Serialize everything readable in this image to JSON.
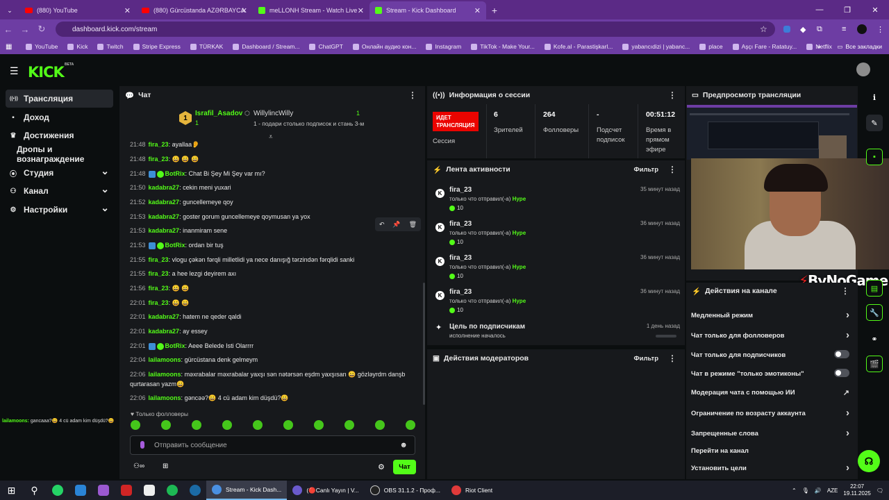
{
  "browser": {
    "tabs": [
      {
        "label": "(880) YouTube",
        "icon": "youtube-icon"
      },
      {
        "label": "(880) Gürcüstanda AZƏRBAYCA",
        "icon": "youtube-icon"
      },
      {
        "label": "meLLONH Stream - Watch Live",
        "icon": "kick-icon"
      },
      {
        "label": "Stream - Kick Dashboard",
        "icon": "kick-icon",
        "active": true
      }
    ],
    "url": "dashboard.kick.com/stream",
    "bookmarks": [
      "YouTube",
      "Kick",
      "Twitch",
      "Stripe Express",
      "TÜRKAK",
      "Dashboard / Stream...",
      "ChatGPT",
      "Онлайн аудио кон...",
      "Instagram",
      "TikTok - Make Your...",
      "Kofe.al - Parastişkarl...",
      "yabancıdizi | yabanc...",
      "place",
      "Aşçı Fare - Ratatuy...",
      "Netflix"
    ],
    "all_bookmarks": "Все закладки"
  },
  "kick": {
    "logo": "KICK",
    "beta": "BETA"
  },
  "sidebar": {
    "items": [
      {
        "label": "Трансляция",
        "icon": "broadcast-icon",
        "selected": true
      },
      {
        "label": "Доход",
        "icon": "wallet-icon"
      },
      {
        "label": "Достижения",
        "icon": "trophy-icon"
      },
      {
        "label": "Дропы и вознаграждение",
        "icon": ""
      },
      {
        "label": "Студия",
        "icon": "camera-icon",
        "chevron": true
      },
      {
        "label": "Канал",
        "icon": "people-icon",
        "chevron": true
      },
      {
        "label": "Настройки",
        "icon": "gear-icon",
        "chevron": true
      }
    ]
  },
  "overlay_msg": {
    "user": "lailamoons:",
    "text": " gancaaa?😀 4 cü adam kim düşdü?😀"
  },
  "chat": {
    "title": "Чат",
    "pinned": {
      "user1": "Israfil_Asadov",
      "user1_count": "1",
      "user2": "WillylincWilly",
      "user2_count": "1",
      "rank": "1",
      "line": "1 - подари столько подписок и стань 3-м"
    },
    "messages": [
      {
        "time": "21:48",
        "user": "fira_23",
        "text": "ayallaa👂"
      },
      {
        "time": "21:48",
        "user": "fira_23",
        "text": "😀 😀 😀"
      },
      {
        "time": "21:48",
        "user": "BotRix",
        "text": "Chat Bi Şey Mi Şey var mı?",
        "bot": true
      },
      {
        "time": "21:50",
        "user": "kadabra27",
        "text": "cekin meni yuxari"
      },
      {
        "time": "21:52",
        "user": "kadabra27",
        "text": "guncellemeye qoy"
      },
      {
        "time": "21:53",
        "user": "kadabra27",
        "text": "goster gorum guncellemeye qoymusan ya yox"
      },
      {
        "time": "21:53",
        "user": "kadabra27",
        "text": "inanmiram sene"
      },
      {
        "time": "21:53",
        "user": "BotRix",
        "text": "ordan bir tuş",
        "bot": true
      },
      {
        "time": "21:55",
        "user": "fira_23",
        "text": "vlogu çəkən fərqli milletlidi ya nece danışığ tərzindən fərqlidi sanki"
      },
      {
        "time": "21:55",
        "user": "fira_23",
        "text": "a hee lezgi deyirem axı"
      },
      {
        "time": "21:56",
        "user": "fira_23",
        "text": "😀 😀"
      },
      {
        "time": "22:01",
        "user": "fira_23",
        "text": "😀 😀"
      },
      {
        "time": "22:01",
        "user": "kadabra27",
        "text": "hatem ne qeder qaldi"
      },
      {
        "time": "22:01",
        "user": "kadabra27",
        "text": "ay essey"
      },
      {
        "time": "22:01",
        "user": "BotRix",
        "text": "Aeee Belede Isti Olarrrr",
        "bot": true
      },
      {
        "time": "22:04",
        "user": "lailamoons",
        "text": "gürcüstana denk gelmeym"
      },
      {
        "time": "22:06",
        "user": "lailamoons",
        "text": "məxrabalar məxrabalar yaxşı sən nətərsən eşdm yaxşısan 😀 gözləyrdm danşb"
      },
      {
        "time": "",
        "user": "",
        "text": "qurtarasan yazm😀",
        "cont": true
      },
      {
        "time": "22:06",
        "user": "lailamoons",
        "text": "gəncəə?😀 4 cü adam kim düşdü?😀"
      }
    ],
    "followers_only": "Только фолловеры",
    "input_placeholder": "Отправить сообщение",
    "send": "Чат"
  },
  "session": {
    "title": "Информация о сессии",
    "live_badge": "ИДЕТ ТРАНСЛЯЦИЯ",
    "session_label": "Сессия",
    "stats": [
      {
        "value": "6",
        "label": "Зрителей"
      },
      {
        "value": "264",
        "label": "Фолловеры"
      },
      {
        "value": "-",
        "label": "Подсчет подписок"
      },
      {
        "value": "00:51:12",
        "label": "Время в прямом эфире"
      }
    ]
  },
  "activity": {
    "title": "Лента активности",
    "filter": "Фильтр",
    "items": [
      {
        "user": "fira_23",
        "text": "только что отправил(-а) ",
        "item": "Hype",
        "count": "10",
        "time": "35 минут назад"
      },
      {
        "user": "fira_23",
        "text": "только что отправил(-а) ",
        "item": "Hype",
        "count": "10",
        "time": "36 минут назад"
      },
      {
        "user": "fira_23",
        "text": "только что отправил(-а) ",
        "item": "Hype",
        "count": "10",
        "time": "36 минут назад"
      },
      {
        "user": "fira_23",
        "text": "только что отправил(-а) ",
        "item": "Hype",
        "count": "10",
        "time": "36 минут назад"
      }
    ],
    "goal": {
      "title": "Цель по подписчикам",
      "status": "исполнение началось",
      "time": "1 день назад"
    }
  },
  "mods": {
    "title": "Действия модераторов",
    "filter": "Фильтр"
  },
  "preview": {
    "title": "Предпросмотр трансляции",
    "watermark": "ByNoGame"
  },
  "channel": {
    "title": "Действия на канале",
    "rows": [
      {
        "label": "Медленный режим",
        "kind": "chevron"
      },
      {
        "label": "Чат только для фолловеров",
        "kind": "chevron"
      },
      {
        "label": "Чат только для подписчиков",
        "kind": "toggle"
      },
      {
        "label": "Чат в режиме \"только эмотиконы\"",
        "kind": "toggle"
      },
      {
        "label": "Модерация чата с помощью ИИ",
        "kind": "external"
      },
      {
        "label": "Ограничение по возрасту аккаунта",
        "kind": "chevron"
      },
      {
        "label": "Запрещенные слова",
        "kind": "chevron"
      },
      {
        "label": "Перейти на канал",
        "kind": "none"
      },
      {
        "label": "Установить цели",
        "kind": "chevron"
      }
    ]
  },
  "taskbar": {
    "apps": [
      {
        "label": "Stream - Kick Dash...",
        "active": true
      },
      {
        "label": "(🔴Canlı Yayın | V...",
        "active": false
      },
      {
        "label": "OBS 31.1.2 - Проф...",
        "active": false
      },
      {
        "label": "Riot Client",
        "active": false
      }
    ],
    "lang": "AZE",
    "time": "22:07",
    "date": "19.11.2025"
  }
}
